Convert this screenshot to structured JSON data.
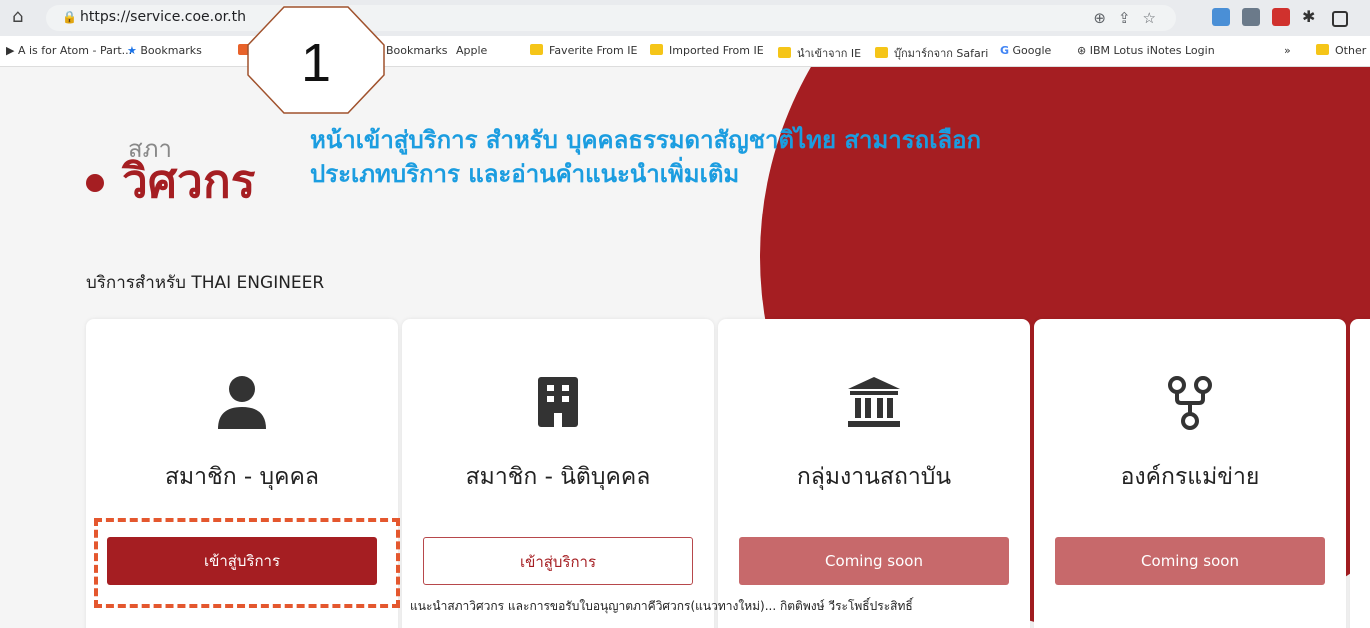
{
  "browser": {
    "url": "https://service.coe.or.th",
    "bookmarks": [
      "A is for Atom - Part...",
      "Bookmarks",
      "Bookmarks",
      "Apple",
      "Faverite From IE",
      "Imported From IE",
      "นำเข้าจาก IE",
      "บุ๊กมาร์กจาก Safari",
      "Google",
      "IBM Lotus iNotes Login",
      "»",
      "Other"
    ]
  },
  "overlay": {
    "step_number": "1",
    "annotation_line1": "หน้าเข้าสู่บริการ สำหรับ บุคคลธรรมดาสัญชาติไทย สามารถเลือก",
    "annotation_line2": "ประเภทบริการ และอ่านคำแนะนำเพิ่มเติม",
    "caption": "แนะนำสภาวิศวกร และการขอรับใบอนุญาตภาคีวิศวกร(แนวทางใหม่)... กิตติพงษ์ วีระโพธิ์ประสิทธิ์"
  },
  "logo": {
    "small": "สภา",
    "big": "วิศวกร"
  },
  "section_title": "บริการสำหรับ THAI ENGINEER",
  "cards": [
    {
      "title": "สมาชิก - บุคคล",
      "button": "เข้าสู่บริการ",
      "icon": "person-icon"
    },
    {
      "title": "สมาชิก - นิติบุคคล",
      "button": "เข้าสู่บริการ",
      "icon": "building-icon"
    },
    {
      "title": "กลุ่มงานสถาบัน",
      "button": "Coming soon",
      "icon": "institution-icon"
    },
    {
      "title": "องค์กรแม่ข่าย",
      "button": "Coming soon",
      "icon": "network-icon"
    }
  ],
  "colors": {
    "brand": "#a51e22",
    "annotation": "#1b9de0",
    "highlight": "#e4572e"
  }
}
